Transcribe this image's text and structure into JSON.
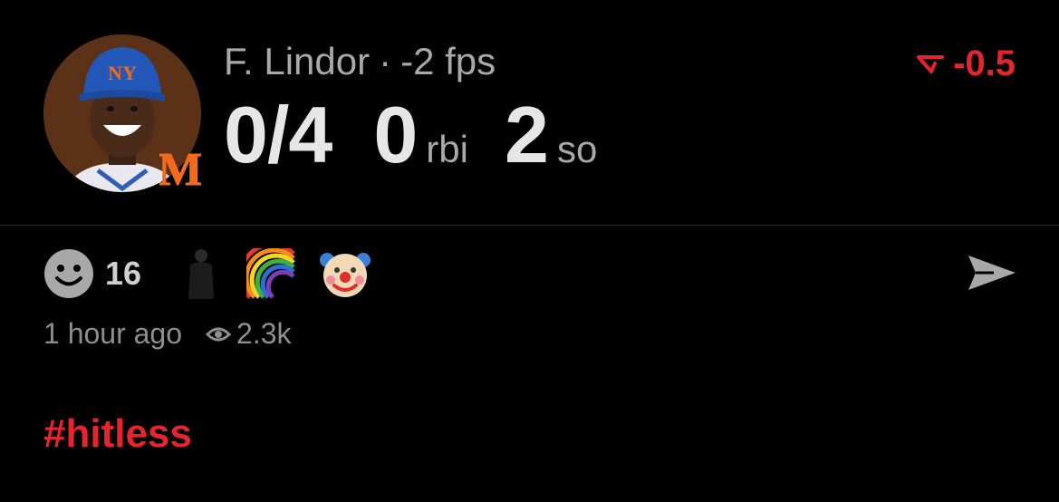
{
  "player": {
    "name": "F. Lindor",
    "separator": "·",
    "fps": "-2 fps"
  },
  "delta": {
    "value": "-0.5",
    "color": "#e5252e"
  },
  "stats": {
    "hits": "0/4",
    "rbi_value": "0",
    "rbi_label": "rbi",
    "so_value": "2",
    "so_label": "so"
  },
  "reactions": {
    "count": "16",
    "items": [
      "silhouette-icon",
      "rainbow-icon",
      "clown-icon"
    ]
  },
  "meta": {
    "time": "1 hour ago",
    "views": "2.3k"
  },
  "hashtag": "#hitless"
}
